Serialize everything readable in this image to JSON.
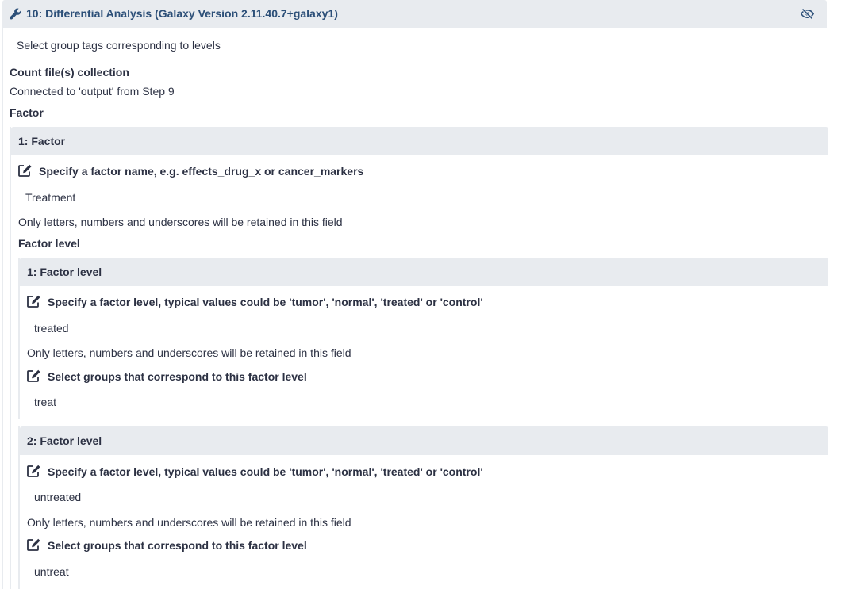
{
  "step": {
    "title": "10: Differential Analysis (Galaxy Version 2.11.40.7+galaxy1)",
    "subtitle": "Select group tags corresponding to levels"
  },
  "collection": {
    "label": "Count file(s) collection",
    "value": "Connected to 'output' from Step 9"
  },
  "factor_section": {
    "label": "Factor",
    "repeat_title": "1: Factor",
    "name_label": "Specify a factor name, e.g. effects_drug_x or cancer_markers",
    "name_value": "Treatment",
    "name_help": "Only letters, numbers and underscores will be retained in this field",
    "levels_label": "Factor level"
  },
  "levels": [
    {
      "title": "1: Factor level",
      "level_label": "Specify a factor level, typical values could be 'tumor', 'normal', 'treated' or 'control'",
      "level_value": "treated",
      "level_help": "Only letters, numbers and underscores will be retained in this field",
      "groups_label": "Select groups that correspond to this factor level",
      "groups_value": "treat"
    },
    {
      "title": "2: Factor level",
      "level_label": "Specify a factor level, typical values could be 'tumor', 'normal', 'treated' or 'control'",
      "level_value": "untreated",
      "level_help": "Only letters, numbers and underscores will be retained in this field",
      "groups_label": "Select groups that correspond to this factor level",
      "groups_value": "untreat"
    }
  ],
  "icons": {
    "header_left": "wrench-icon",
    "header_right": "eye-slash-icon",
    "field": "edit-icon"
  },
  "colors": {
    "header_bg": "#e8ebef",
    "header_title": "#2c4f78",
    "text": "#2c3143"
  }
}
